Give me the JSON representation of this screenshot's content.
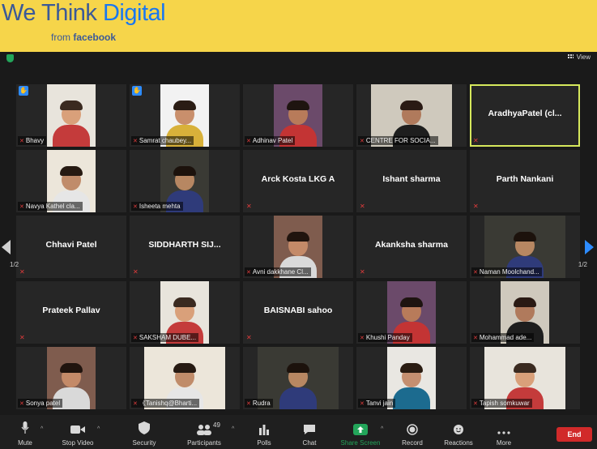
{
  "banner": {
    "title_part1": "We Think ",
    "title_part2": "Digital",
    "sub_from": "from ",
    "sub_brand": "facebook"
  },
  "topbar": {
    "view_label": "View"
  },
  "participants": [
    {
      "name": "Bhavy",
      "video": true,
      "hand": true
    },
    {
      "name": "Samrat chaubey...",
      "video": true,
      "hand": true
    },
    {
      "name": "Adhinav Patel",
      "video": true
    },
    {
      "name": "CENTRE FOR SOCIA...",
      "video": true
    },
    {
      "name": "AradhyaPatel  (cl...",
      "video": false,
      "active": true
    },
    {
      "name": "Navya Kathel cla...",
      "video": true
    },
    {
      "name": "Isheeta mehta",
      "video": true
    },
    {
      "name": "Arck Kosta LKG A",
      "video": false
    },
    {
      "name": "Ishant sharma",
      "video": false
    },
    {
      "name": "Parth Nankani",
      "video": false
    },
    {
      "name": "Chhavi Patel",
      "video": false
    },
    {
      "name": "SIDDHARTH  SIJ...",
      "video": false
    },
    {
      "name": "Avni dakkhane Cl...",
      "video": true
    },
    {
      "name": "Akanksha sharma",
      "video": false
    },
    {
      "name": "Naman Moolchand...",
      "video": true
    },
    {
      "name": "Prateek Pallav",
      "video": false
    },
    {
      "name": "SAKSHAM DUBE...",
      "video": true
    },
    {
      "name": "BAISNABI  sahoo",
      "video": false
    },
    {
      "name": "Khushi Panday",
      "video": true
    },
    {
      "name": "Mohammad ade...",
      "video": true
    },
    {
      "name": "Sonya patel",
      "video": true
    },
    {
      "name": "《Tanishq@Bharti...",
      "video": true
    },
    {
      "name": "Rudra",
      "video": true
    },
    {
      "name": "Tanvi jain",
      "video": true
    },
    {
      "name": "Tapish somkuwar",
      "video": true
    }
  ],
  "pagination": {
    "left": "1/2",
    "right": "1/2"
  },
  "toolbar": {
    "mute": "Mute",
    "stop_video": "Stop Video",
    "security": "Security",
    "participants": "Participants",
    "participants_count": "49",
    "polls": "Polls",
    "chat": "Chat",
    "share_screen": "Share Screen",
    "record": "Record",
    "reactions": "Reactions",
    "more": "More",
    "end": "End"
  },
  "colors": {
    "banner": "#f6d54a",
    "accent_blue": "#2d8cff",
    "share_green": "#23a55a",
    "end_red": "#d12a2a",
    "active_border": "#d6e85c"
  }
}
